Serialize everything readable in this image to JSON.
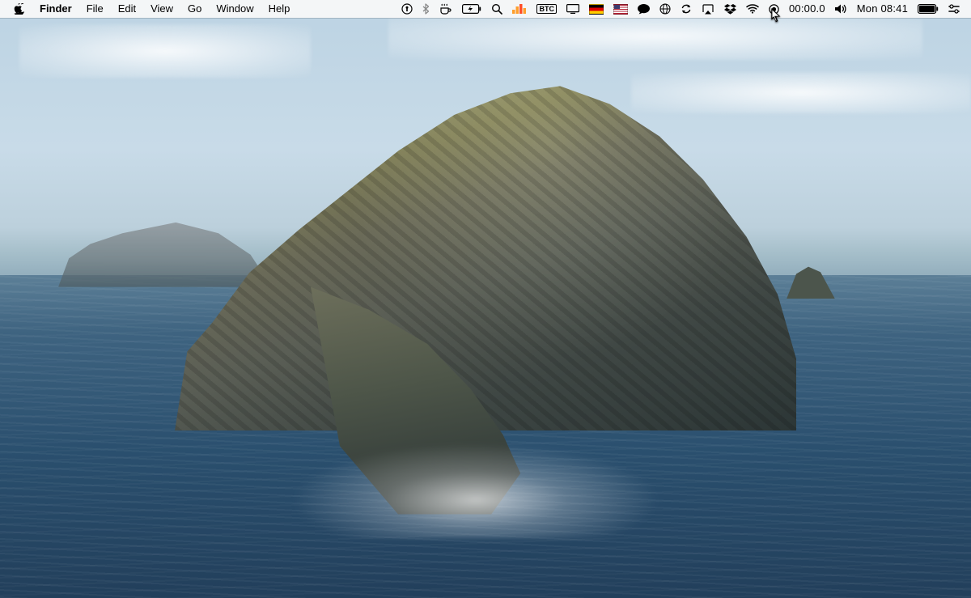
{
  "menubar": {
    "app_name": "Finder",
    "menus": [
      "File",
      "Edit",
      "View",
      "Go",
      "Window",
      "Help"
    ]
  },
  "status": {
    "timer": "00:00.0",
    "clock": "Mon 08:41",
    "input_source_1": "DE",
    "input_source_2": "US",
    "btc_label": "BTC"
  }
}
